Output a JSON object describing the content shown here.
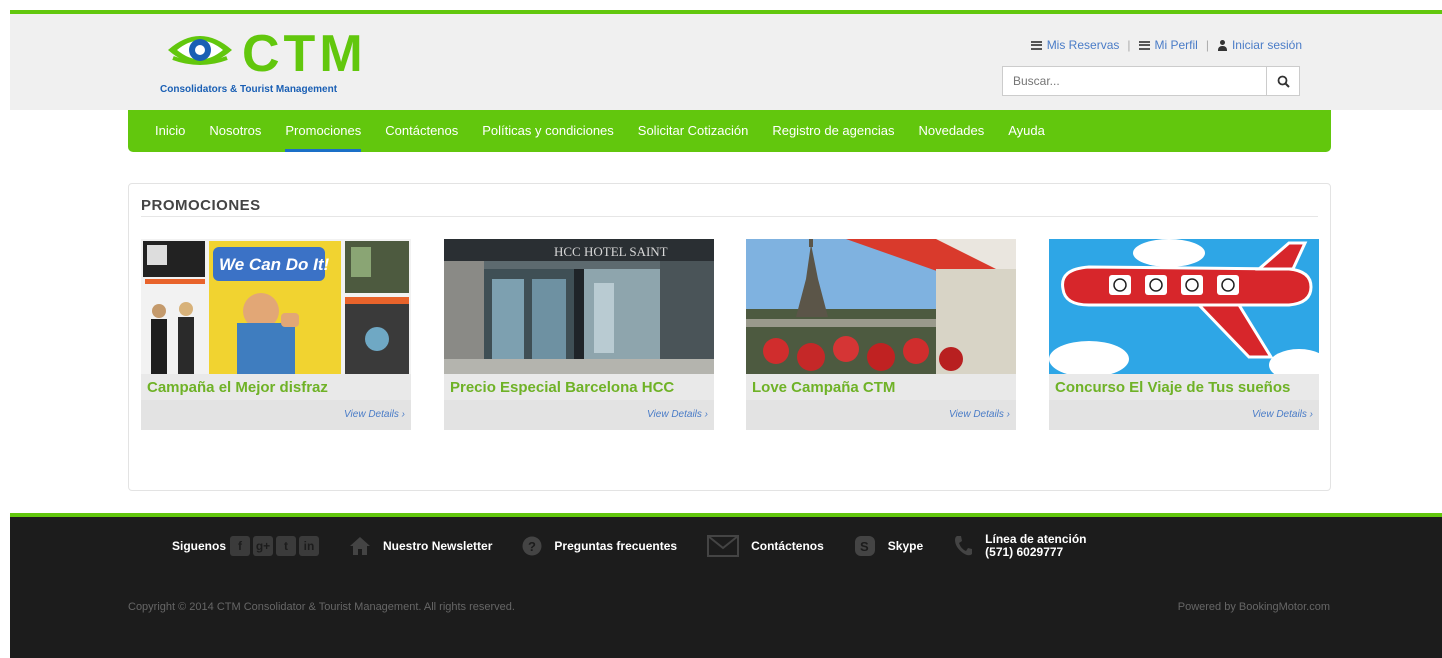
{
  "brand": {
    "name": "CTM",
    "tagline": "Consolidators & Tourist Management",
    "primary_color": "#62c70d",
    "link_color": "#4a7cc7"
  },
  "top_links": [
    {
      "label": "Mis Reservas",
      "icon": "list-icon"
    },
    {
      "label": "Mi Perfil",
      "icon": "list-icon"
    },
    {
      "label": "Iniciar sesión",
      "icon": "user-icon"
    }
  ],
  "search": {
    "placeholder": "Buscar..."
  },
  "nav": {
    "items": [
      "Inicio",
      "Nosotros",
      "Promociones",
      "Contáctenos",
      "Políticas y condiciones",
      "Solicitar Cotización",
      "Registro de agencias",
      "Novedades",
      "Ayuda"
    ],
    "active": "Promociones"
  },
  "promotions": {
    "title": "PROMOCIONES",
    "cards": [
      {
        "title": "Campaña el Mejor disfraz",
        "link": "View Details ›"
      },
      {
        "title": "Precio Especial Barcelona HCC",
        "link": "View Details ›"
      },
      {
        "title": "Love Campaña CTM",
        "link": "View Details ›"
      },
      {
        "title": "Concurso El Viaje de Tus sueños",
        "link": "View Details ›"
      }
    ],
    "image_texts": {
      "costume": "We Can Do It!",
      "hotel": "HCC HOTEL SAINT"
    }
  },
  "footer": {
    "follow_label": "Siguenos",
    "social": [
      "f",
      "g+",
      "t",
      "in"
    ],
    "newsletter": "Nuestro Newsletter",
    "faq": "Preguntas frecuentes",
    "contact": "Contáctenos",
    "skype": "Skype",
    "phone_label": "Línea de atención",
    "phone_number": "(571) 6029777",
    "copyright": "Copyright © 2014 CTM Consolidator & Tourist Management. All rights reserved.",
    "powered": "Powered by BookingMotor.com"
  }
}
